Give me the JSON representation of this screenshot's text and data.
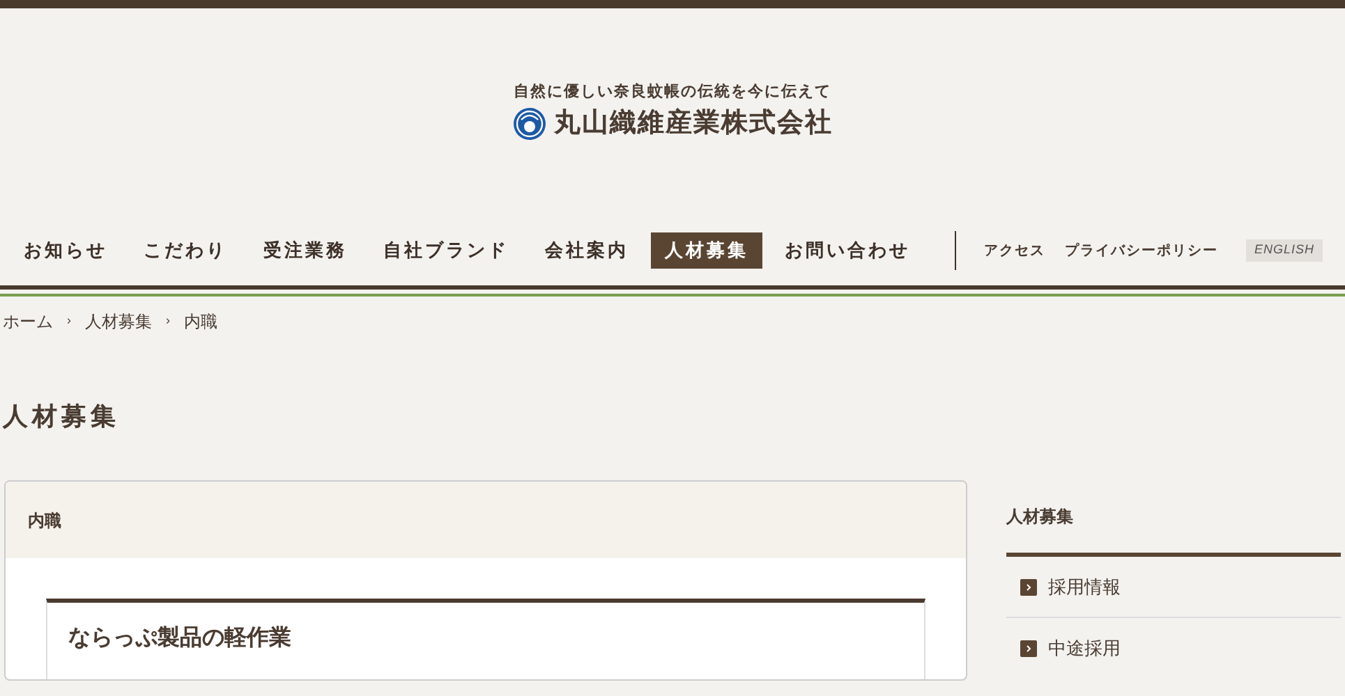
{
  "header": {
    "tagline": "自然に優しい奈良蚊帳の伝統を今に伝えて",
    "company": "丸山織維産業株式会社"
  },
  "nav": {
    "items": [
      {
        "label": "お知らせ",
        "selected": false
      },
      {
        "label": "こだわり",
        "selected": false
      },
      {
        "label": "受注業務",
        "selected": false
      },
      {
        "label": "自社ブランド",
        "selected": false
      },
      {
        "label": "会社案内",
        "selected": false
      },
      {
        "label": "人材募集",
        "selected": true
      },
      {
        "label": "お問い合わせ",
        "selected": false
      }
    ],
    "sub_items": [
      {
        "label": "アクセス",
        "kind": "link"
      },
      {
        "label": "プライバシーポリシー",
        "kind": "link"
      },
      {
        "label": "ENGLISH",
        "kind": "badge"
      }
    ]
  },
  "breadcrumb": {
    "separator": "›",
    "items": [
      "ホーム",
      "人材募集",
      "内職"
    ]
  },
  "page_title": "人材募集",
  "card": {
    "header": "内職",
    "section_title": "ならっぷ製品の軽作業"
  },
  "sidebar": {
    "heading": "人材募集",
    "items": [
      "採用情報",
      "中途採用"
    ]
  }
}
